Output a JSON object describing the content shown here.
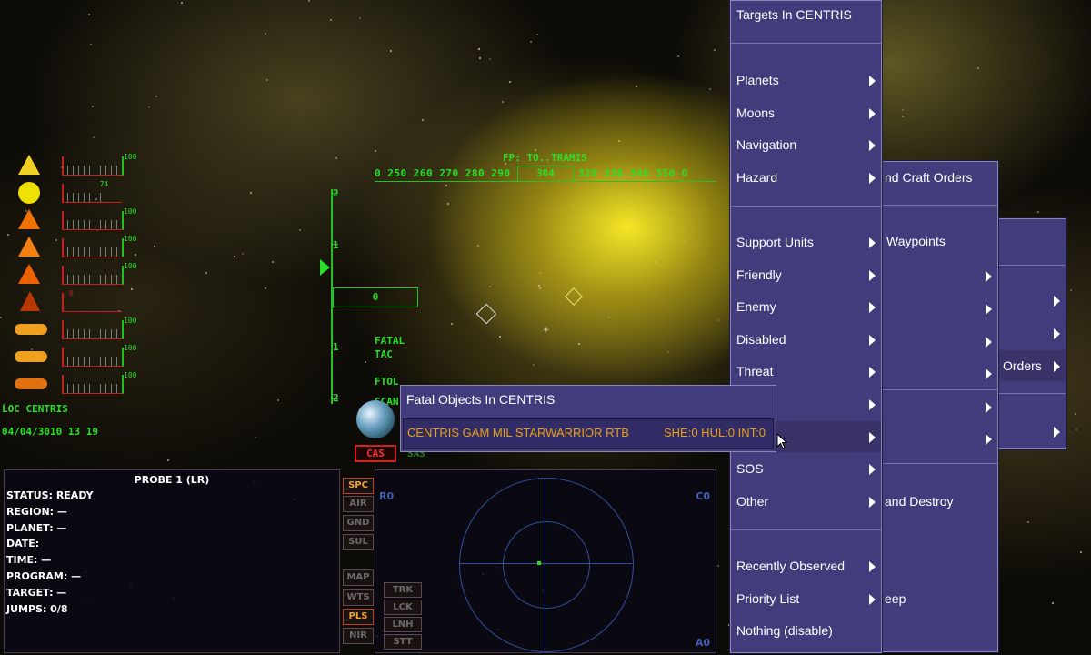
{
  "hud": {
    "location": "LOC CENTRIS",
    "datetime": "04/04/3010 13 19",
    "flight_plan": "FP: TO..TRAMIS",
    "heading_tape": "0 250 260 270 280 290",
    "heading_tape_right": "320 330 340 350   0",
    "heading": "304",
    "pitch_labels": [
      "2",
      "1",
      "1",
      "2"
    ],
    "speed": "0",
    "modes": [
      "FATAL",
      "TAC",
      "FTOL",
      "SCAN"
    ],
    "cas_label": "CAS",
    "sas_label": "SAS"
  },
  "status_gauges": [
    {
      "icon": "radiation-icon",
      "value": "100"
    },
    {
      "icon": "sun-icon",
      "value": "74"
    },
    {
      "icon": "shield-triangle-icon",
      "value": "100"
    },
    {
      "icon": "hull-triangle-icon",
      "value": "100"
    },
    {
      "icon": "engine-cone-icon",
      "value": "100"
    },
    {
      "icon": "fire-icon",
      "value": "0"
    },
    {
      "icon": "ammo-icon",
      "value": "100"
    },
    {
      "icon": "turret-icon",
      "value": "100"
    },
    {
      "icon": "cannon-icon",
      "value": "100"
    }
  ],
  "probe": {
    "title": "PROBE 1 (LR)",
    "lines": [
      "STATUS: READY",
      "REGION: —",
      "PLANET: —",
      "DATE:",
      "TIME: —",
      "PROGRAM: —",
      "TARGET: —",
      "JUMPS: 0/8"
    ]
  },
  "mode_buttons": [
    "SPC",
    "AIR",
    "GND",
    "SUL",
    "MAP",
    "WTS",
    "PLS",
    "NIR"
  ],
  "tag_buttons": [
    "TRK",
    "LCK",
    "LNH",
    "STT"
  ],
  "radar": {
    "left_label": "R0",
    "right_label": "C0",
    "bottom_label": "A0"
  },
  "targets_menu": {
    "header": "Targets In CENTRIS",
    "group1": [
      "Planets",
      "Moons",
      "Navigation",
      "Hazard"
    ],
    "group2": [
      "Support Units",
      "Friendly",
      "Enemy",
      "Disabled",
      "Threat",
      "",
      "",
      "SOS",
      "Other"
    ],
    "group3": [
      "Recently Observed",
      "Priority List",
      "Nothing (disable)"
    ]
  },
  "orders_menu": {
    "items": [
      "nd Craft Orders",
      "Waypoints",
      "",
      "",
      "",
      "",
      "",
      "",
      "",
      "and Destroy",
      "",
      "eep"
    ]
  },
  "third_menu": {
    "items": [
      "Orders"
    ]
  },
  "fatal": {
    "title": "Fatal Objects In CENTRIS",
    "entry": {
      "name": "CENTRIS  GAM  MIL  STARWARRIOR  RTB",
      "status": "SHE:0  HUL:0  INT:0"
    }
  }
}
